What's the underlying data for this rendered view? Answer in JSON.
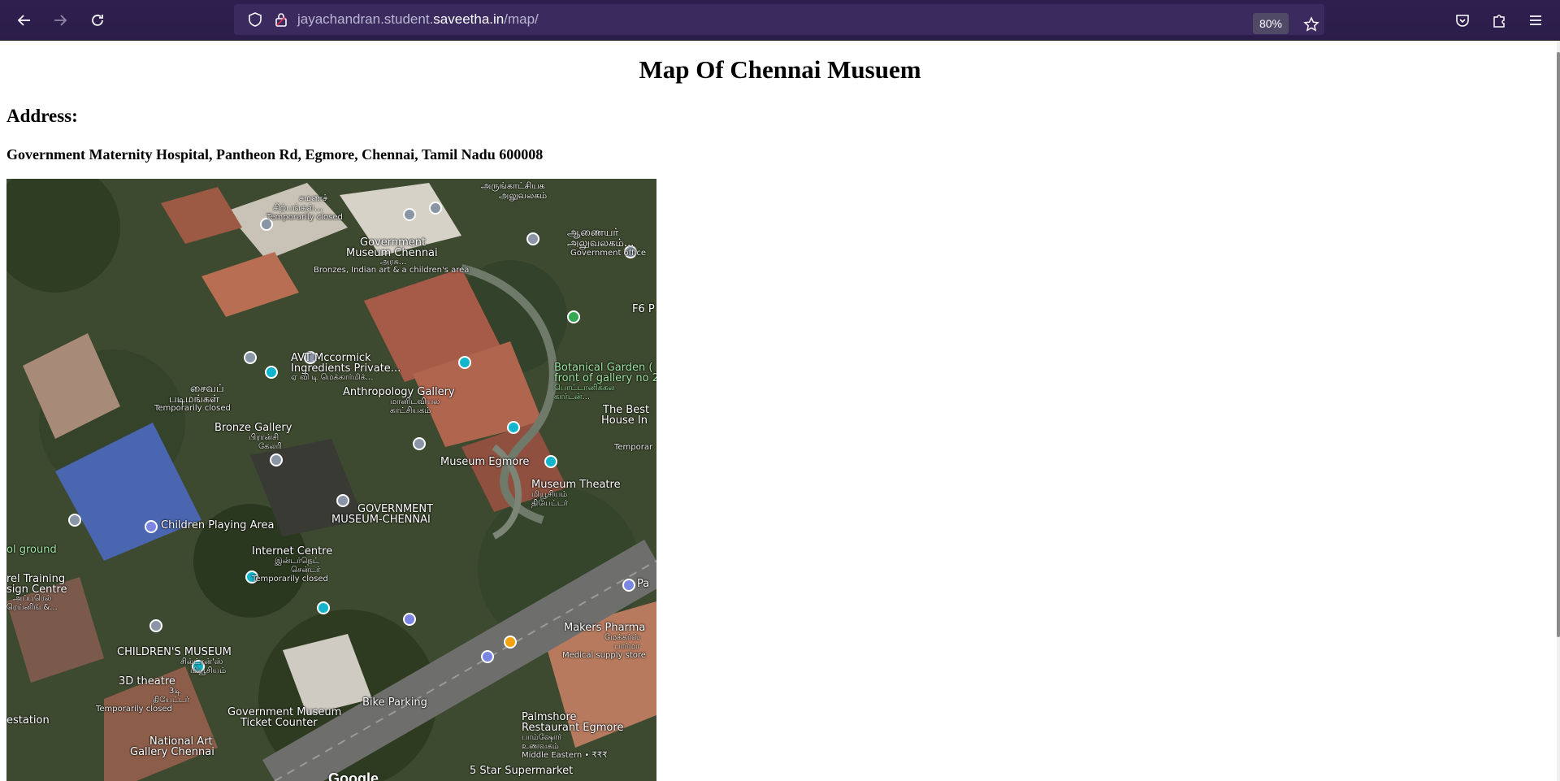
{
  "browser": {
    "url_prefix": "jayachandran.student.",
    "url_domain": "saveetha.in",
    "url_path": "/map/",
    "zoom_label": "80%"
  },
  "page": {
    "title": "Map Of Chennai Musuem",
    "address_heading": "Address:",
    "address_text": "Government Maternity Hospital, Pantheon Rd, Egmore, Chennai, Tamil Nadu 600008"
  },
  "map": {
    "brand": "Google",
    "labels": {
      "arungatchi": "அருங்காட்சியக",
      "aluvalagam": "அலுவலகம்",
      "samana": "சமணச்",
      "sirpangal": "சிற்பங்கள்...",
      "temp_closed_1": "Temporarily closed",
      "gov_museum": "Government",
      "gov_museum_2": "Museum Chennai",
      "arasu": "அரசு...",
      "bronzes": "Bronzes, Indian art & a children's area",
      "anaiyar": "ஆணையர்",
      "aluvalagam2": "அலுவலகம்...",
      "gov_office": "Government office",
      "f6": "F6 P",
      "avt": "AVT Mccormick",
      "avt2": "Ingredients Private...",
      "avt3": "ஏ வி டி மெக்கார்மிக்...",
      "saiva": "சைவப்",
      "padimangal": "படிமங்கள்",
      "temp_closed_2": "Temporarily closed",
      "anthropology": "Anthropology Gallery",
      "manidaviyal": "மானிடவியல",
      "kaatchiyagam": "காட்சியகம்",
      "botanical": "Botanical Garden (",
      "botanical2": "front of gallery no 2",
      "botanical3": "பொட்டானிக்கல",
      "botanical4": "கார்டன்...",
      "best": "The Best",
      "best2": "House In",
      "temp_closed_3": "Temporar",
      "bronze_gallery": "Bronze Gallery",
      "piranchi": "பிரான்சி",
      "gallery_ta": "கேலரி",
      "museum_egmore": "Museum Egmore",
      "museum_theatre": "Museum Theatre",
      "museum_theatre2": "மியூசியம்",
      "museum_theatre3": "தியேட்டர்",
      "gov_museum_caps": "GOVERNMENT",
      "gov_museum_caps2": "MUSEUM-CHENNAI",
      "ground": "ol ground",
      "training": "rel Training",
      "training2": "sign Centre",
      "training3": "அப்பரெல்",
      "training4": "ரெய்னிங் &...",
      "internet": "Internet Centre",
      "internet2": "இன்டர்நெட்",
      "internet3": "சென்டர்",
      "temp_closed_4": "Temporarily closed",
      "children_area": "Children Playing Area",
      "makers": "Makers Pharma",
      "makers2": "மேக்கர்ஸ்",
      "makers3": "பார்மா",
      "medical": "Medical supply store",
      "pa": "Pa",
      "childrens_museum": "CHILDREN'S MUSEUM",
      "childrens_museum2": "சில்ட்ரன்'ஸ்",
      "childrens_museum3": "மியூசியம்",
      "theatre3d": "3D theatre",
      "theatre3d_2": "3டி",
      "theatre3d_3": "தியேட்டர்",
      "temp_closed_5": "Temporarily closed",
      "ticket": "Government Museum",
      "ticket2": "Ticket Counter",
      "bike": "Bike Parking",
      "palmshore": "Palmshore",
      "palmshore2": "Restaurant Egmore",
      "palmshore3": "பாம்ஷோர்",
      "palmshore4": "உணவகம்",
      "palmshore5": "Middle Eastern • ₹₹₹",
      "estation": "estation",
      "nag": "National Art",
      "nag2": "Gallery Chennai",
      "supermarket": "5 Star Supermarket"
    }
  },
  "colors": {
    "toolbar": "#2b1d4a",
    "urlbar": "#3a2a5e"
  }
}
